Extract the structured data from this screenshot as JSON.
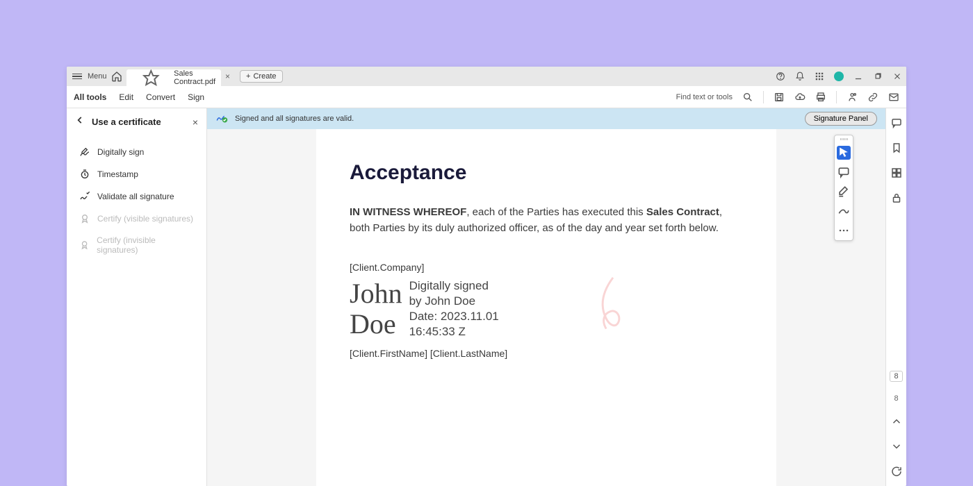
{
  "titlebar": {
    "menu_label": "Menu",
    "tab_title": "Sales Contract.pdf",
    "create_label": "Create"
  },
  "toolbar": {
    "all_tools": "All tools",
    "edit": "Edit",
    "convert": "Convert",
    "sign": "Sign",
    "find_placeholder": "Find text or tools"
  },
  "sidebar": {
    "title": "Use a certificate",
    "items": [
      {
        "label": "Digitally sign",
        "disabled": false,
        "icon": "pen"
      },
      {
        "label": "Timestamp",
        "disabled": false,
        "icon": "clock"
      },
      {
        "label": "Validate all signature",
        "disabled": false,
        "icon": "check"
      },
      {
        "label": "Certify (visible signatures)",
        "disabled": true,
        "icon": "ribbon"
      },
      {
        "label": "Certify (invisible signatures)",
        "disabled": true,
        "icon": "ribbon"
      }
    ]
  },
  "banner": {
    "text": "Signed and all signatures are valid.",
    "button": "Signature Panel"
  },
  "document": {
    "heading": "Acceptance",
    "para_lead": "IN WITNESS WHEREOF",
    "para_mid": ", each of the Parties has executed this ",
    "para_bold2": "Sales Contract",
    "para_tail": ", both Parties by its duly authorized officer, as of the day and year set forth below.",
    "client_company": "[Client.Company]",
    "sig_name_line1": "John",
    "sig_name_line2": "Doe",
    "sig_meta_line1": "Digitally signed",
    "sig_meta_line2": "by John Doe",
    "sig_meta_line3": "Date: 2023.11.01",
    "sig_meta_line4": "16:45:33 Z",
    "client_name": "[Client.FirstName] [Client.LastName]"
  },
  "paging": {
    "current": "8",
    "total": "8"
  }
}
